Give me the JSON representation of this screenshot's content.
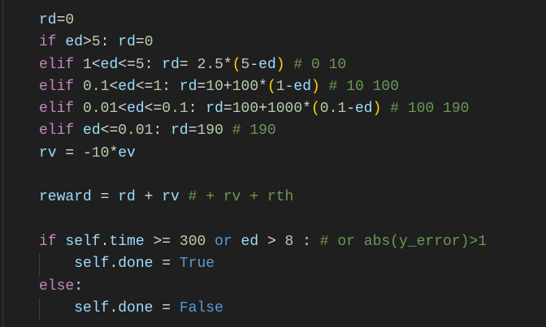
{
  "editor": {
    "colors": {
      "background": "#1f1f1f",
      "keyword": "#c586c0",
      "variable": "#9cdcfe",
      "number": "#b5cea8",
      "comment": "#6a9955",
      "constant": "#569cd6",
      "paren": "#ffd700",
      "operator": "#d4d4d4"
    },
    "lines": [
      {
        "indent": false,
        "tokens": [
          [
            "var",
            "rd"
          ],
          [
            "op",
            "="
          ],
          [
            "num",
            "0"
          ]
        ]
      },
      {
        "indent": false,
        "tokens": [
          [
            "kw",
            "if"
          ],
          [
            "op",
            " "
          ],
          [
            "var",
            "ed"
          ],
          [
            "op",
            ">"
          ],
          [
            "num",
            "5"
          ],
          [
            "op",
            ": "
          ],
          [
            "var",
            "rd"
          ],
          [
            "op",
            "="
          ],
          [
            "num",
            "0"
          ]
        ]
      },
      {
        "indent": false,
        "tokens": [
          [
            "kw",
            "elif"
          ],
          [
            "op",
            " "
          ],
          [
            "num",
            "1"
          ],
          [
            "op",
            "<"
          ],
          [
            "var",
            "ed"
          ],
          [
            "op",
            "<="
          ],
          [
            "num",
            "5"
          ],
          [
            "op",
            ": "
          ],
          [
            "var",
            "rd"
          ],
          [
            "op",
            "= "
          ],
          [
            "num",
            "2.5"
          ],
          [
            "op",
            "*"
          ],
          [
            "par",
            "("
          ],
          [
            "num",
            "5"
          ],
          [
            "op",
            "-"
          ],
          [
            "var",
            "ed"
          ],
          [
            "par",
            ")"
          ],
          [
            "op",
            " "
          ],
          [
            "com",
            "# 0 10"
          ]
        ]
      },
      {
        "indent": false,
        "tokens": [
          [
            "kw",
            "elif"
          ],
          [
            "op",
            " "
          ],
          [
            "num",
            "0.1"
          ],
          [
            "op",
            "<"
          ],
          [
            "var",
            "ed"
          ],
          [
            "op",
            "<="
          ],
          [
            "num",
            "1"
          ],
          [
            "op",
            ": "
          ],
          [
            "var",
            "rd"
          ],
          [
            "op",
            "="
          ],
          [
            "num",
            "10"
          ],
          [
            "op",
            "+"
          ],
          [
            "num",
            "100"
          ],
          [
            "op",
            "*"
          ],
          [
            "par",
            "("
          ],
          [
            "num",
            "1"
          ],
          [
            "op",
            "-"
          ],
          [
            "var",
            "ed"
          ],
          [
            "par",
            ")"
          ],
          [
            "op",
            " "
          ],
          [
            "com",
            "# 10 100"
          ]
        ]
      },
      {
        "indent": false,
        "tokens": [
          [
            "kw",
            "elif"
          ],
          [
            "op",
            " "
          ],
          [
            "num",
            "0.01"
          ],
          [
            "op",
            "<"
          ],
          [
            "var",
            "ed"
          ],
          [
            "op",
            "<="
          ],
          [
            "num",
            "0.1"
          ],
          [
            "op",
            ": "
          ],
          [
            "var",
            "rd"
          ],
          [
            "op",
            "="
          ],
          [
            "num",
            "100"
          ],
          [
            "op",
            "+"
          ],
          [
            "num",
            "1000"
          ],
          [
            "op",
            "*"
          ],
          [
            "par",
            "("
          ],
          [
            "num",
            "0.1"
          ],
          [
            "op",
            "-"
          ],
          [
            "var",
            "ed"
          ],
          [
            "par",
            ")"
          ],
          [
            "op",
            " "
          ],
          [
            "com",
            "# 100 190"
          ]
        ]
      },
      {
        "indent": false,
        "tokens": [
          [
            "kw",
            "elif"
          ],
          [
            "op",
            " "
          ],
          [
            "var",
            "ed"
          ],
          [
            "op",
            "<="
          ],
          [
            "num",
            "0.01"
          ],
          [
            "op",
            ": "
          ],
          [
            "var",
            "rd"
          ],
          [
            "op",
            "="
          ],
          [
            "num",
            "190"
          ],
          [
            "op",
            " "
          ],
          [
            "com",
            "# 190"
          ]
        ]
      },
      {
        "indent": false,
        "tokens": [
          [
            "var",
            "rv"
          ],
          [
            "op",
            " = "
          ],
          [
            "op",
            "-"
          ],
          [
            "num",
            "10"
          ],
          [
            "op",
            "*"
          ],
          [
            "var",
            "ev"
          ]
        ]
      },
      {
        "indent": false,
        "tokens": []
      },
      {
        "indent": false,
        "tokens": [
          [
            "var",
            "reward"
          ],
          [
            "op",
            " = "
          ],
          [
            "var",
            "rd"
          ],
          [
            "op",
            " + "
          ],
          [
            "var",
            "rv"
          ],
          [
            "op",
            " "
          ],
          [
            "com",
            "# + rv + rth"
          ]
        ]
      },
      {
        "indent": false,
        "tokens": []
      },
      {
        "indent": false,
        "tokens": [
          [
            "kw",
            "if"
          ],
          [
            "op",
            " "
          ],
          [
            "var",
            "self"
          ],
          [
            "op",
            "."
          ],
          [
            "var",
            "time"
          ],
          [
            "op",
            " >= "
          ],
          [
            "num",
            "300"
          ],
          [
            "op",
            " "
          ],
          [
            "const",
            "or"
          ],
          [
            "op",
            " "
          ],
          [
            "var",
            "ed"
          ],
          [
            "op",
            " > "
          ],
          [
            "num",
            "8"
          ],
          [
            "op",
            " : "
          ],
          [
            "com",
            "# or abs(y_error)>1"
          ]
        ]
      },
      {
        "indent": true,
        "tokens": [
          [
            "op",
            "    "
          ],
          [
            "var",
            "self"
          ],
          [
            "op",
            "."
          ],
          [
            "var",
            "done"
          ],
          [
            "op",
            " = "
          ],
          [
            "const",
            "True"
          ]
        ]
      },
      {
        "indent": false,
        "tokens": [
          [
            "kw",
            "else"
          ],
          [
            "op",
            ":"
          ]
        ]
      },
      {
        "indent": true,
        "tokens": [
          [
            "op",
            "    "
          ],
          [
            "var",
            "self"
          ],
          [
            "op",
            "."
          ],
          [
            "var",
            "done"
          ],
          [
            "op",
            " = "
          ],
          [
            "const",
            "False"
          ]
        ]
      }
    ]
  }
}
